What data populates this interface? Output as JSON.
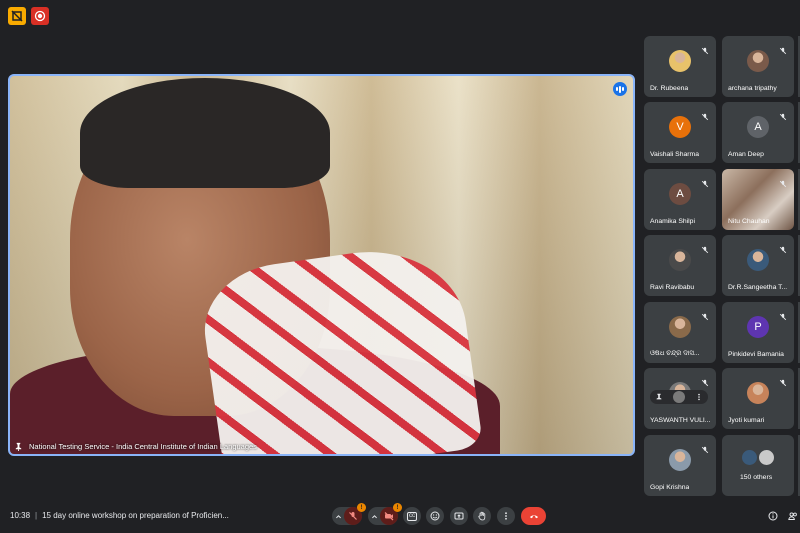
{
  "top_bar": {
    "icons": [
      {
        "name": "rec-indicator-icon",
        "color": "#f9ab00"
      },
      {
        "name": "record-icon",
        "color": "#d93025"
      }
    ]
  },
  "main_video": {
    "label": "National Testing Service - India Central Institute of Indian Languages",
    "pin_icon": "pin-icon",
    "speaking_icon": "speaking-icon"
  },
  "participants": [
    {
      "name": "Dr. Rubeena",
      "avatar_type": "photo",
      "avatar_color": "#e8c26a"
    },
    {
      "name": "archana tripathy",
      "avatar_type": "photo",
      "avatar_color": "#7a5a4a"
    },
    {
      "name": "Vaishali Sharma",
      "avatar_type": "letter",
      "letter": "V",
      "avatar_color": "#e8710a"
    },
    {
      "name": "Aman Deep",
      "avatar_type": "letter",
      "letter": "A",
      "avatar_color": "#5f6368"
    },
    {
      "name": "Anamika Shilpi",
      "avatar_type": "letter",
      "letter": "A",
      "avatar_color": "#6d4c41"
    },
    {
      "name": "Nitu Chauhan",
      "avatar_type": "video",
      "avatar_color": "#a58a76"
    },
    {
      "name": "Ravi Ravibabu",
      "avatar_type": "photo",
      "avatar_color": "#4a4a4a"
    },
    {
      "name": "Dr.R.Sangeetha T...",
      "avatar_type": "photo",
      "avatar_color": "#3a5a7a"
    },
    {
      "name": "ଓଷଧ ଚନ୍ଦ୍ର ଦାସ...",
      "avatar_type": "photo",
      "avatar_color": "#8a6a4a"
    },
    {
      "name": "Pinkidevi Bamania",
      "avatar_type": "letter",
      "letter": "P",
      "avatar_color": "#5e35b1"
    },
    {
      "name": "YASWANTH VULI...",
      "avatar_type": "photo",
      "avatar_color": "#7a7a7a"
    },
    {
      "name": "Jyoti kumari",
      "avatar_type": "photo",
      "avatar_color": "#c7835a"
    },
    {
      "name": "Gopi Krishna",
      "avatar_type": "photo",
      "avatar_color": "#8a9aaa"
    },
    {
      "name": "150 others",
      "avatar_type": "group",
      "avatar_color": "#3a5a7a"
    }
  ],
  "bottom_bar": {
    "time": "10:38",
    "separator": "|",
    "meeting_title": "15 day online workshop on preparation of Proficien...",
    "mic_badge": "!",
    "cam_badge": "!",
    "cc_label": "cc"
  }
}
